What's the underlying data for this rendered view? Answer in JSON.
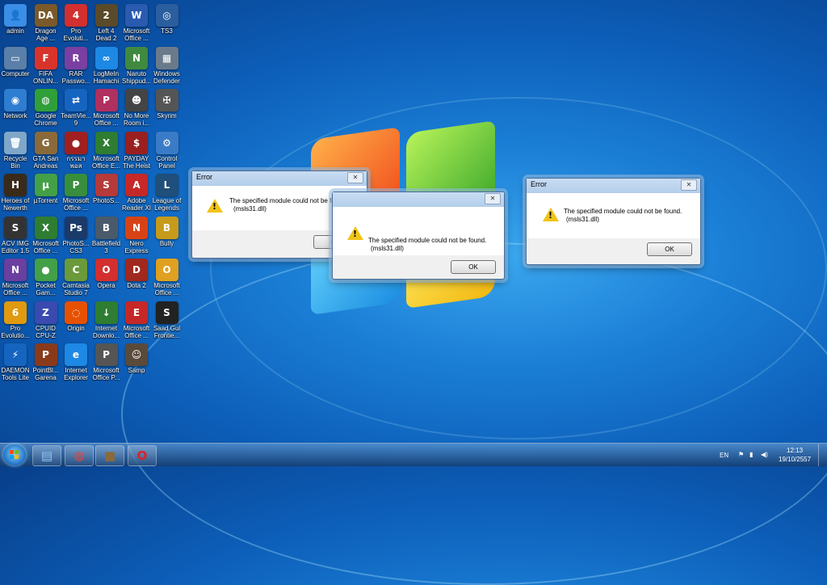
{
  "desktop_icons": [
    {
      "label": "admin",
      "color": "#3a8ee6",
      "glyph": "👤"
    },
    {
      "label": "Dragon Age ...",
      "color": "#7a5a2a",
      "glyph": "DA"
    },
    {
      "label": "Pro Evoluti...",
      "color": "#d32f2f",
      "glyph": "4"
    },
    {
      "label": "Left 4 Dead 2",
      "color": "#5a4a2a",
      "glyph": "2"
    },
    {
      "label": "Microsoft Office ...",
      "color": "#2a5bb0",
      "glyph": "W"
    },
    {
      "label": "TS3",
      "color": "#2b5e9e",
      "glyph": "◎"
    },
    {
      "label": "Computer",
      "color": "#5a7fa8",
      "glyph": "▭"
    },
    {
      "label": "FIFA ONLIN...",
      "color": "#d8342b",
      "glyph": "F"
    },
    {
      "label": "RAR Passwo...",
      "color": "#7a3fa0",
      "glyph": "R"
    },
    {
      "label": "LogMeIn Hamachi",
      "color": "#1e88e5",
      "glyph": "∞"
    },
    {
      "label": "Naruto Shippud...",
      "color": "#3f8a3f",
      "glyph": "N"
    },
    {
      "label": "Windows Defender",
      "color": "#6b7a8a",
      "glyph": "▦"
    },
    {
      "label": "Network",
      "color": "#2e7dd1",
      "glyph": "◉"
    },
    {
      "label": "Google Chrome",
      "color": "#2f9f3a",
      "glyph": "◍"
    },
    {
      "label": "TeamVie... 9",
      "color": "#1565c0",
      "glyph": "⇄"
    },
    {
      "label": "Microsoft Office ...",
      "color": "#b03060",
      "glyph": "P"
    },
    {
      "label": "No More Room i...",
      "color": "#444",
      "glyph": "☻"
    },
    {
      "label": "Skyrim",
      "color": "#555",
      "glyph": "✠"
    },
    {
      "label": "Recycle Bin",
      "color": "#7fa7c9",
      "glyph": "🗑"
    },
    {
      "label": "GTA San Andreas",
      "color": "#8a6a3a",
      "glyph": "G"
    },
    {
      "label": "กรรมา พอส",
      "color": "#a02020",
      "glyph": "●"
    },
    {
      "label": "Microsoft Office E...",
      "color": "#2e7d32",
      "glyph": "X"
    },
    {
      "label": "PAYDAY The Heist",
      "color": "#9a1f1f",
      "glyph": "$"
    },
    {
      "label": "Control Panel",
      "color": "#3a7bc8",
      "glyph": "⚙"
    },
    {
      "label": "Heroes of Newerth",
      "color": "#3a2a1a",
      "glyph": "H"
    },
    {
      "label": "µTorrent",
      "color": "#43a047",
      "glyph": "µ"
    },
    {
      "label": "Microsoft Office ...",
      "color": "#388e3c",
      "glyph": "P"
    },
    {
      "label": "PhotoS...",
      "color": "#b53a3a",
      "glyph": "S"
    },
    {
      "label": "Adobe Reader XI",
      "color": "#c62828",
      "glyph": "A"
    },
    {
      "label": "League of Legends",
      "color": "#1f4f7a",
      "glyph": "L"
    },
    {
      "label": "ACV IMG Editor 1.5",
      "color": "#333",
      "glyph": "S"
    },
    {
      "label": "Microsoft Office ...",
      "color": "#2e7d32",
      "glyph": "X"
    },
    {
      "label": "PhotoS... CS3",
      "color": "#1a3a6a",
      "glyph": "Ps"
    },
    {
      "label": "Battlefield 3",
      "color": "#4a5a6a",
      "glyph": "B"
    },
    {
      "label": "Nero Express",
      "color": "#d84315",
      "glyph": "N"
    },
    {
      "label": "Bully",
      "color": "#c69a1a",
      "glyph": "B"
    },
    {
      "label": "Microsoft Office ...",
      "color": "#6a3fa0",
      "glyph": "N"
    },
    {
      "label": "Pocket Gam...",
      "color": "#43a047",
      "glyph": "●"
    },
    {
      "label": "Camtasia Studio 7",
      "color": "#6a9a3a",
      "glyph": "C"
    },
    {
      "label": "Opera",
      "color": "#d32f2f",
      "glyph": "O"
    },
    {
      "label": "Dota 2",
      "color": "#a0281e",
      "glyph": "D"
    },
    {
      "label": "Microsoft Office ...",
      "color": "#e0a020",
      "glyph": "O"
    },
    {
      "label": "Pro Evolutio...",
      "color": "#e09a10",
      "glyph": "6"
    },
    {
      "label": "CPUID CPU-Z",
      "color": "#3a4ab0",
      "glyph": "Z"
    },
    {
      "label": "Origin",
      "color": "#e65100",
      "glyph": "◌"
    },
    {
      "label": "Internet Downlo...",
      "color": "#2e7d32",
      "glyph": "↓"
    },
    {
      "label": "Microsoft Office ...",
      "color": "#c62828",
      "glyph": "E"
    },
    {
      "label": "Saad Gul Frontie...",
      "color": "#222",
      "glyph": "S"
    },
    {
      "label": "DAEMON Tools Lite",
      "color": "#1565c0",
      "glyph": "⚡"
    },
    {
      "label": "PointBl... Garena",
      "color": "#8a3a1a",
      "glyph": "P"
    },
    {
      "label": "Internet Explorer",
      "color": "#1e88e5",
      "glyph": "e"
    },
    {
      "label": "Microsoft Office P...",
      "color": "#555",
      "glyph": "P"
    },
    {
      "label": "Samp",
      "color": "#5a4a3a",
      "glyph": "☺"
    }
  ],
  "dialogs": [
    {
      "title": "Error",
      "message_line1": "The specified module could not be found.",
      "message_line2": "(msls31.dll)",
      "ok_label": "OK",
      "close_glyph": "✕",
      "warn_glyph": "!"
    },
    {
      "title": "",
      "message_line1": "The specified module could not be found.",
      "message_line2": "(msls31.dll)",
      "ok_label": "OK",
      "close_glyph": "✕",
      "warn_glyph": "!"
    },
    {
      "title": "Error",
      "message_line1": "The specified module could not be found.",
      "message_line2": "(msls31.dll)",
      "ok_label": "OK",
      "close_glyph": "✕",
      "warn_glyph": "!"
    }
  ],
  "taskbar": {
    "pinned": [
      {
        "name": "explorer-taskbar-button",
        "glyph": "▤",
        "color": "#8fc6f0"
      },
      {
        "name": "chrome-taskbar-button",
        "glyph": "◍",
        "color": "#e8453c"
      },
      {
        "name": "gta-taskbar-button",
        "glyph": "■",
        "color": "#8a6a3a"
      },
      {
        "name": "opera-taskbar-button",
        "glyph": "O",
        "color": "#e02020"
      }
    ],
    "language": "EN",
    "time": "12:13",
    "date": "19/10/2557"
  }
}
